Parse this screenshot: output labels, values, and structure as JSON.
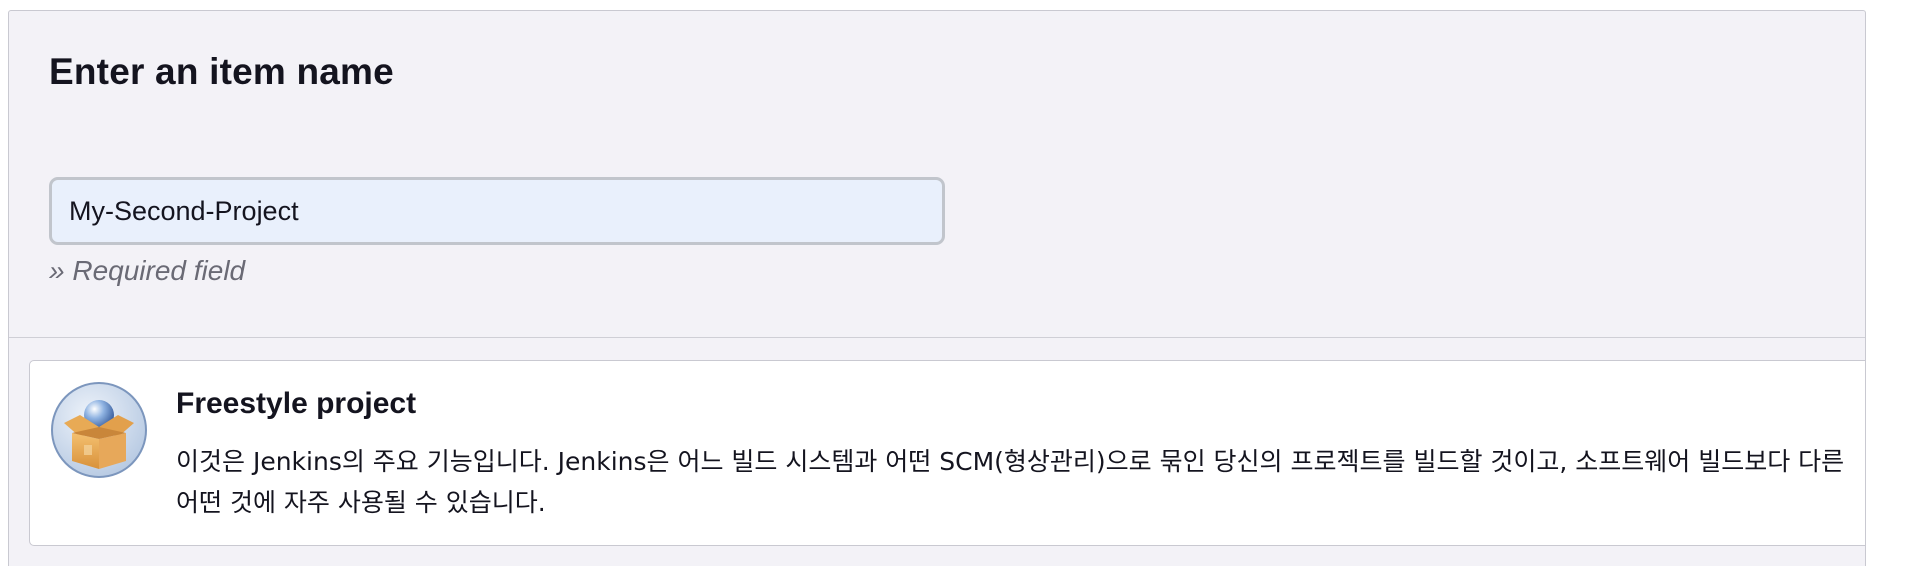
{
  "form": {
    "title": "Enter an item name",
    "item_name_value": "My-Second-Project",
    "required_note": "» Required field"
  },
  "item_types": [
    {
      "label": "Freestyle project",
      "description": "이것은 Jenkins의 주요 기능입니다. Jenkins은 어느 빌드 시스템과 어떤 SCM(형상관리)으로 묶인 당신의 프로젝트를 빌드할 것이고, 소프트웨어 빌드보다 다른 어떤 것에 자주 사용될 수 있습니다.",
      "icon": "freestyle-project-box-icon"
    }
  ]
}
